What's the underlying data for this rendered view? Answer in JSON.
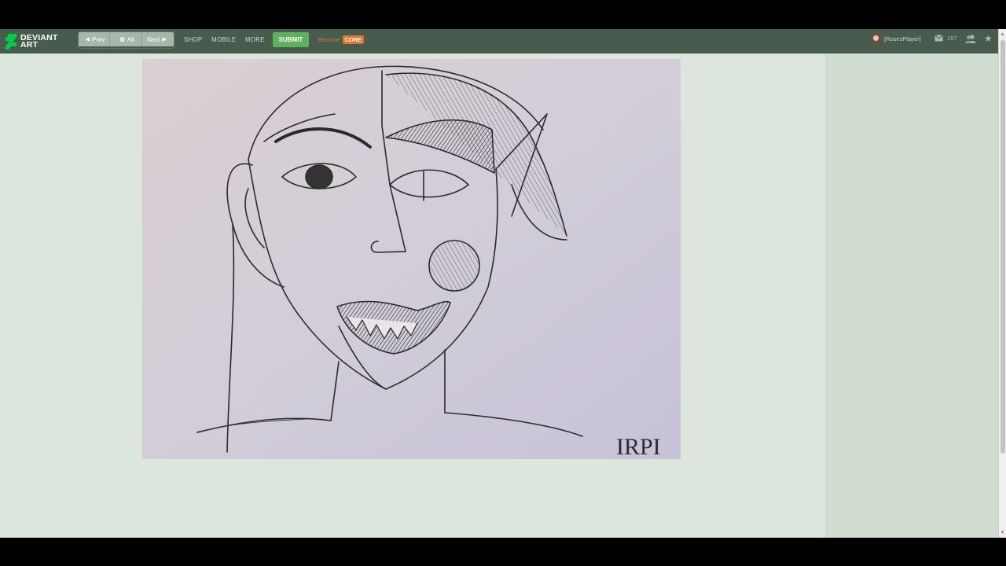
{
  "logo": {
    "line1": "DEVIANT",
    "line2": "ART"
  },
  "nav": {
    "prev_label": "Prev",
    "all_label": "All",
    "next_label": "Next"
  },
  "menu": {
    "shop": "SHOP",
    "mobile": "MOBILE",
    "more": "MORE"
  },
  "submit_label": "SUBMIT",
  "become": {
    "text": "Become",
    "core": "CORE"
  },
  "user": {
    "name": "[RosesPlayer]",
    "messages_count": "197"
  },
  "artwork": {
    "signature": "IRPI"
  },
  "colors": {
    "topbar": "#475c4d",
    "submit": "#5fb15e",
    "core": "#e0742e",
    "page_bg": "#dde6dc",
    "sidebar_bg": "#d2ddd2"
  },
  "icons": [
    "da-logo-icon",
    "chevron-left-icon",
    "grid-icon",
    "chevron-right-icon",
    "avatar",
    "envelope-icon",
    "friends-icon",
    "star-icon"
  ]
}
